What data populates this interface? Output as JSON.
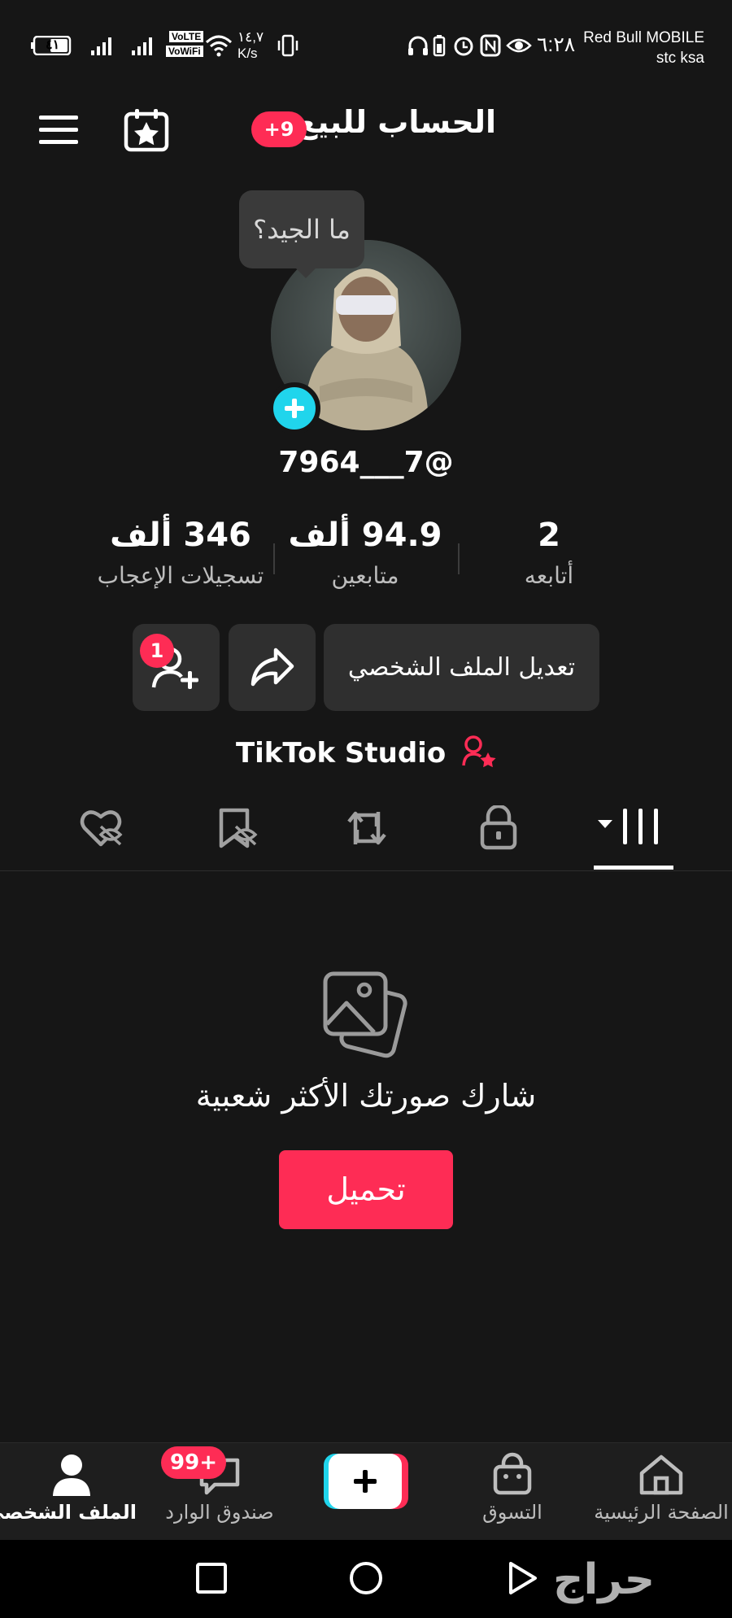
{
  "status_bar": {
    "carrier_1": "Red Bull MOBILE",
    "carrier_2": "stc ksa",
    "time": "٦:٢٨",
    "speed_value": "١٤,٧",
    "speed_unit": "K/s",
    "volte": "VoLTE",
    "vowifi": "VoWiFi",
    "battery": "٤١"
  },
  "header": {
    "title": "الحساب للبيع",
    "badge": "+9"
  },
  "profile": {
    "tooltip": "ما الجيد؟",
    "username": "7964___7@"
  },
  "stats": [
    {
      "value": "2",
      "label": "أتابعه"
    },
    {
      "value": "94.9 ألف",
      "label": "متابعين"
    },
    {
      "value": "346 ألف",
      "label": "تسجيلات الإعجاب"
    }
  ],
  "actions": {
    "edit_profile": "تعديل الملف الشخصي",
    "add_friend_badge": "1"
  },
  "studio": {
    "label": "TikTok Studio"
  },
  "empty_state": {
    "text": "شارك صورتك الأكثر شعبية",
    "upload": "تحميل"
  },
  "bottom_nav": {
    "home": "الصفحة الرئيسية",
    "shop": "التسوق",
    "inbox": "صندوق الوارد",
    "inbox_badge": "99+",
    "profile": "الملف الشخصي"
  },
  "watermark": "حراج",
  "colors": {
    "accent": "#fe2c55",
    "cyan": "#20d5ec",
    "background": "#161616"
  }
}
